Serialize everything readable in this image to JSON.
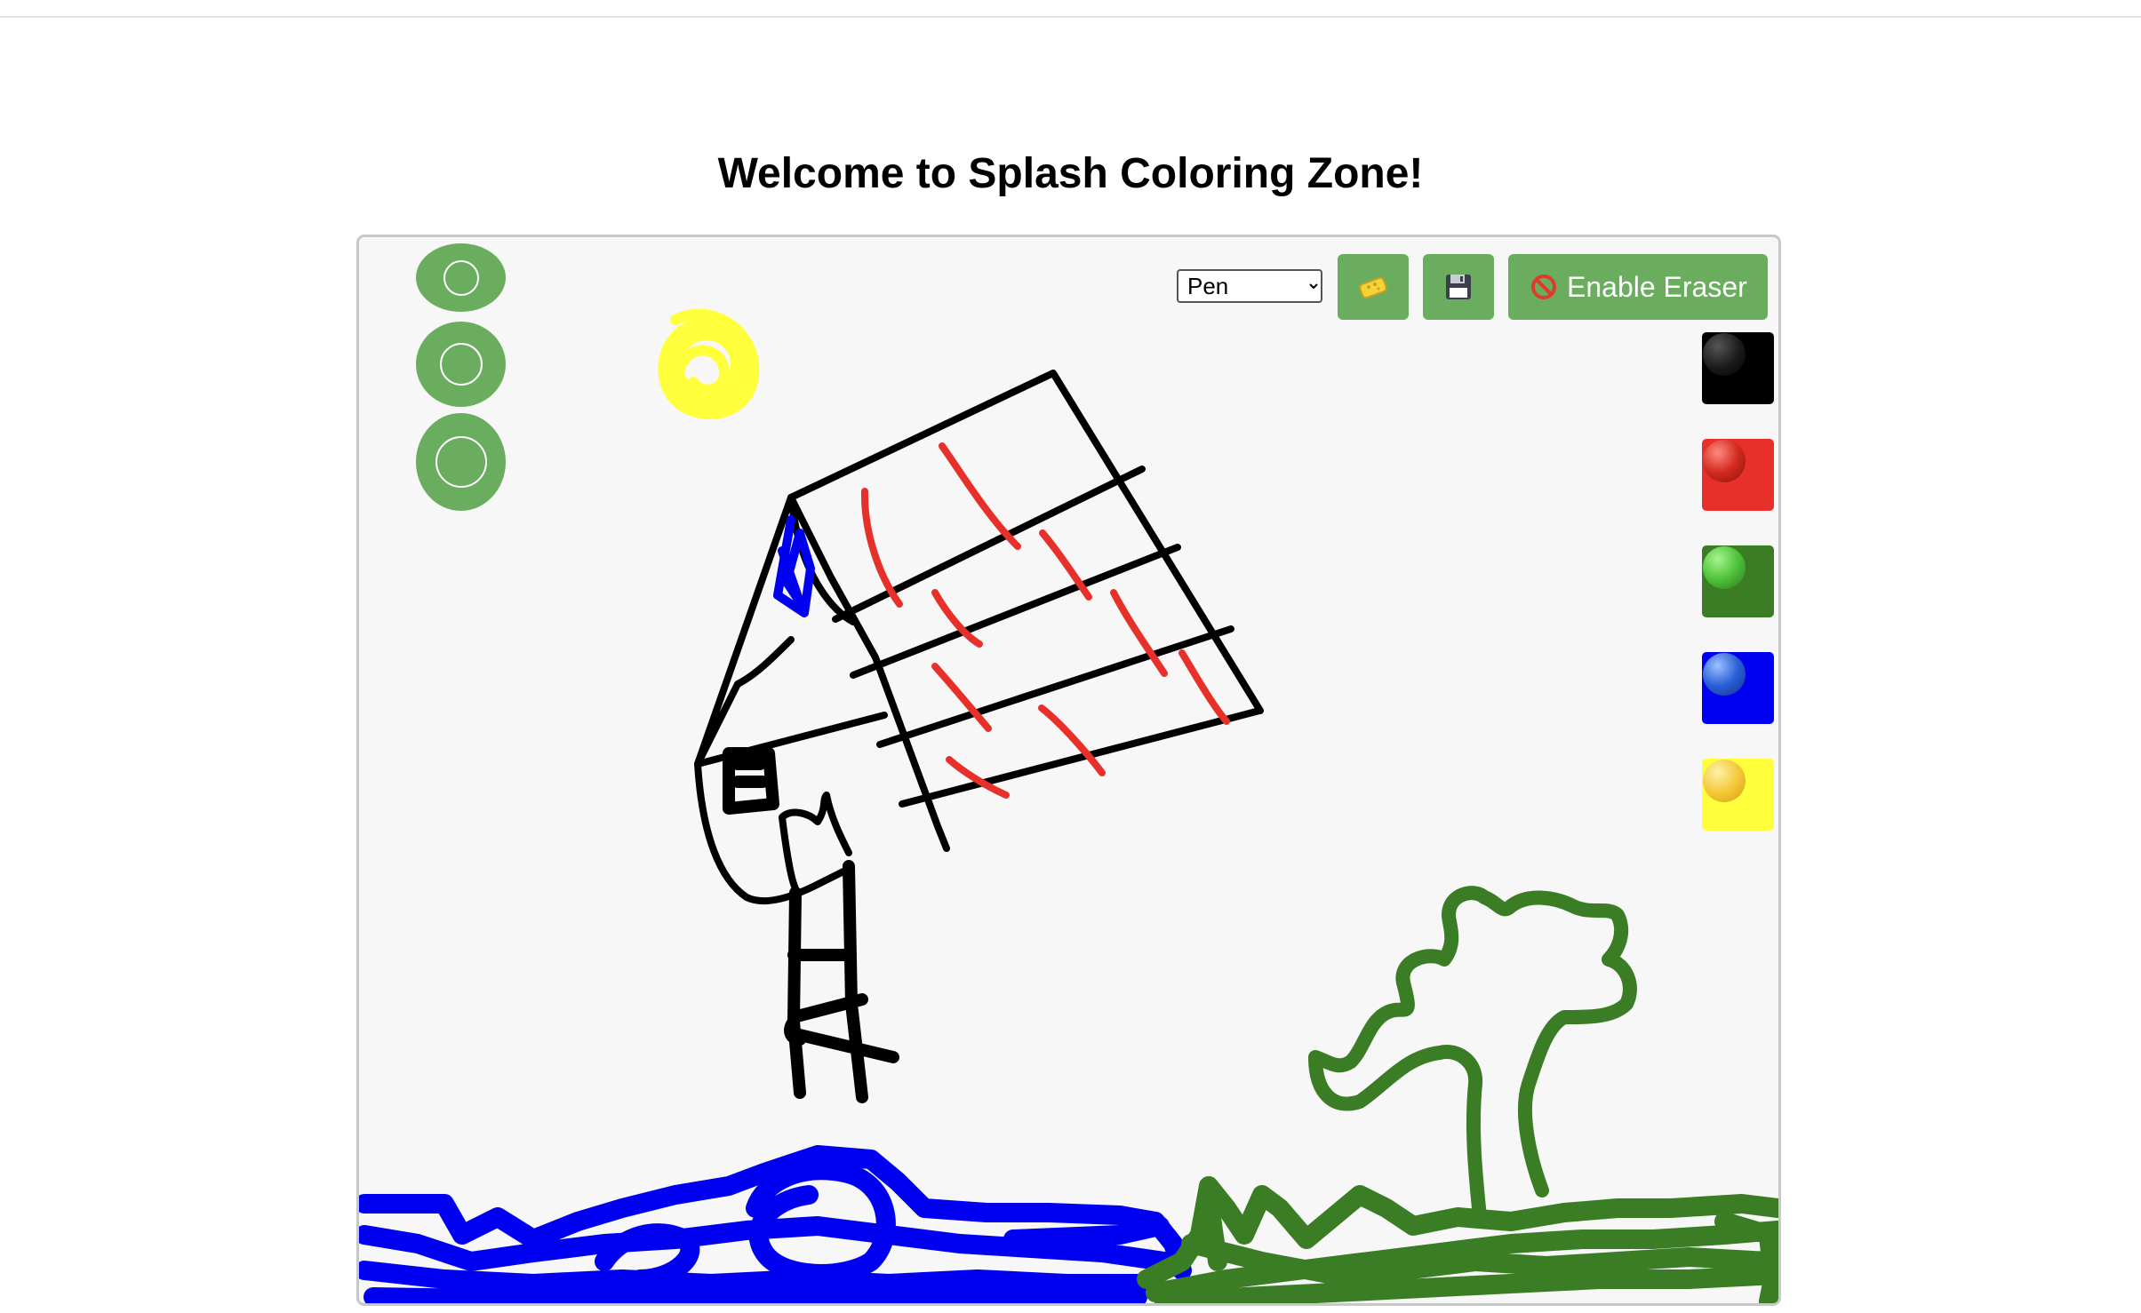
{
  "page": {
    "title": "Welcome to Splash Coloring Zone!"
  },
  "toolbar": {
    "tool_select": {
      "selected": "Pen",
      "options": [
        "Pen"
      ]
    },
    "sponge_button_icon": "sponge-icon",
    "save_button_icon": "floppy-disk-icon",
    "eraser_toggle": {
      "icon": "no-entry-icon",
      "label": "Enable Eraser"
    }
  },
  "brush_sizes": [
    {
      "name": "small",
      "icon": "circle-icon"
    },
    {
      "name": "medium",
      "icon": "circle-icon"
    },
    {
      "name": "large",
      "icon": "circle-icon"
    }
  ],
  "palette": [
    {
      "name": "black",
      "color": "#000000",
      "ball": "#202020"
    },
    {
      "name": "red",
      "color": "#e8302a",
      "ball": "#c0281f"
    },
    {
      "name": "green",
      "color": "#3a7d25",
      "ball": "#4fc23a"
    },
    {
      "name": "blue",
      "color": "#0000f0",
      "ball": "#2a5fd8"
    },
    {
      "name": "yellow",
      "color": "#ffff3b",
      "ball": "#f2c531"
    }
  ],
  "colors": {
    "accent": "#6aad5e",
    "canvas_background": "#f7f7f7"
  }
}
